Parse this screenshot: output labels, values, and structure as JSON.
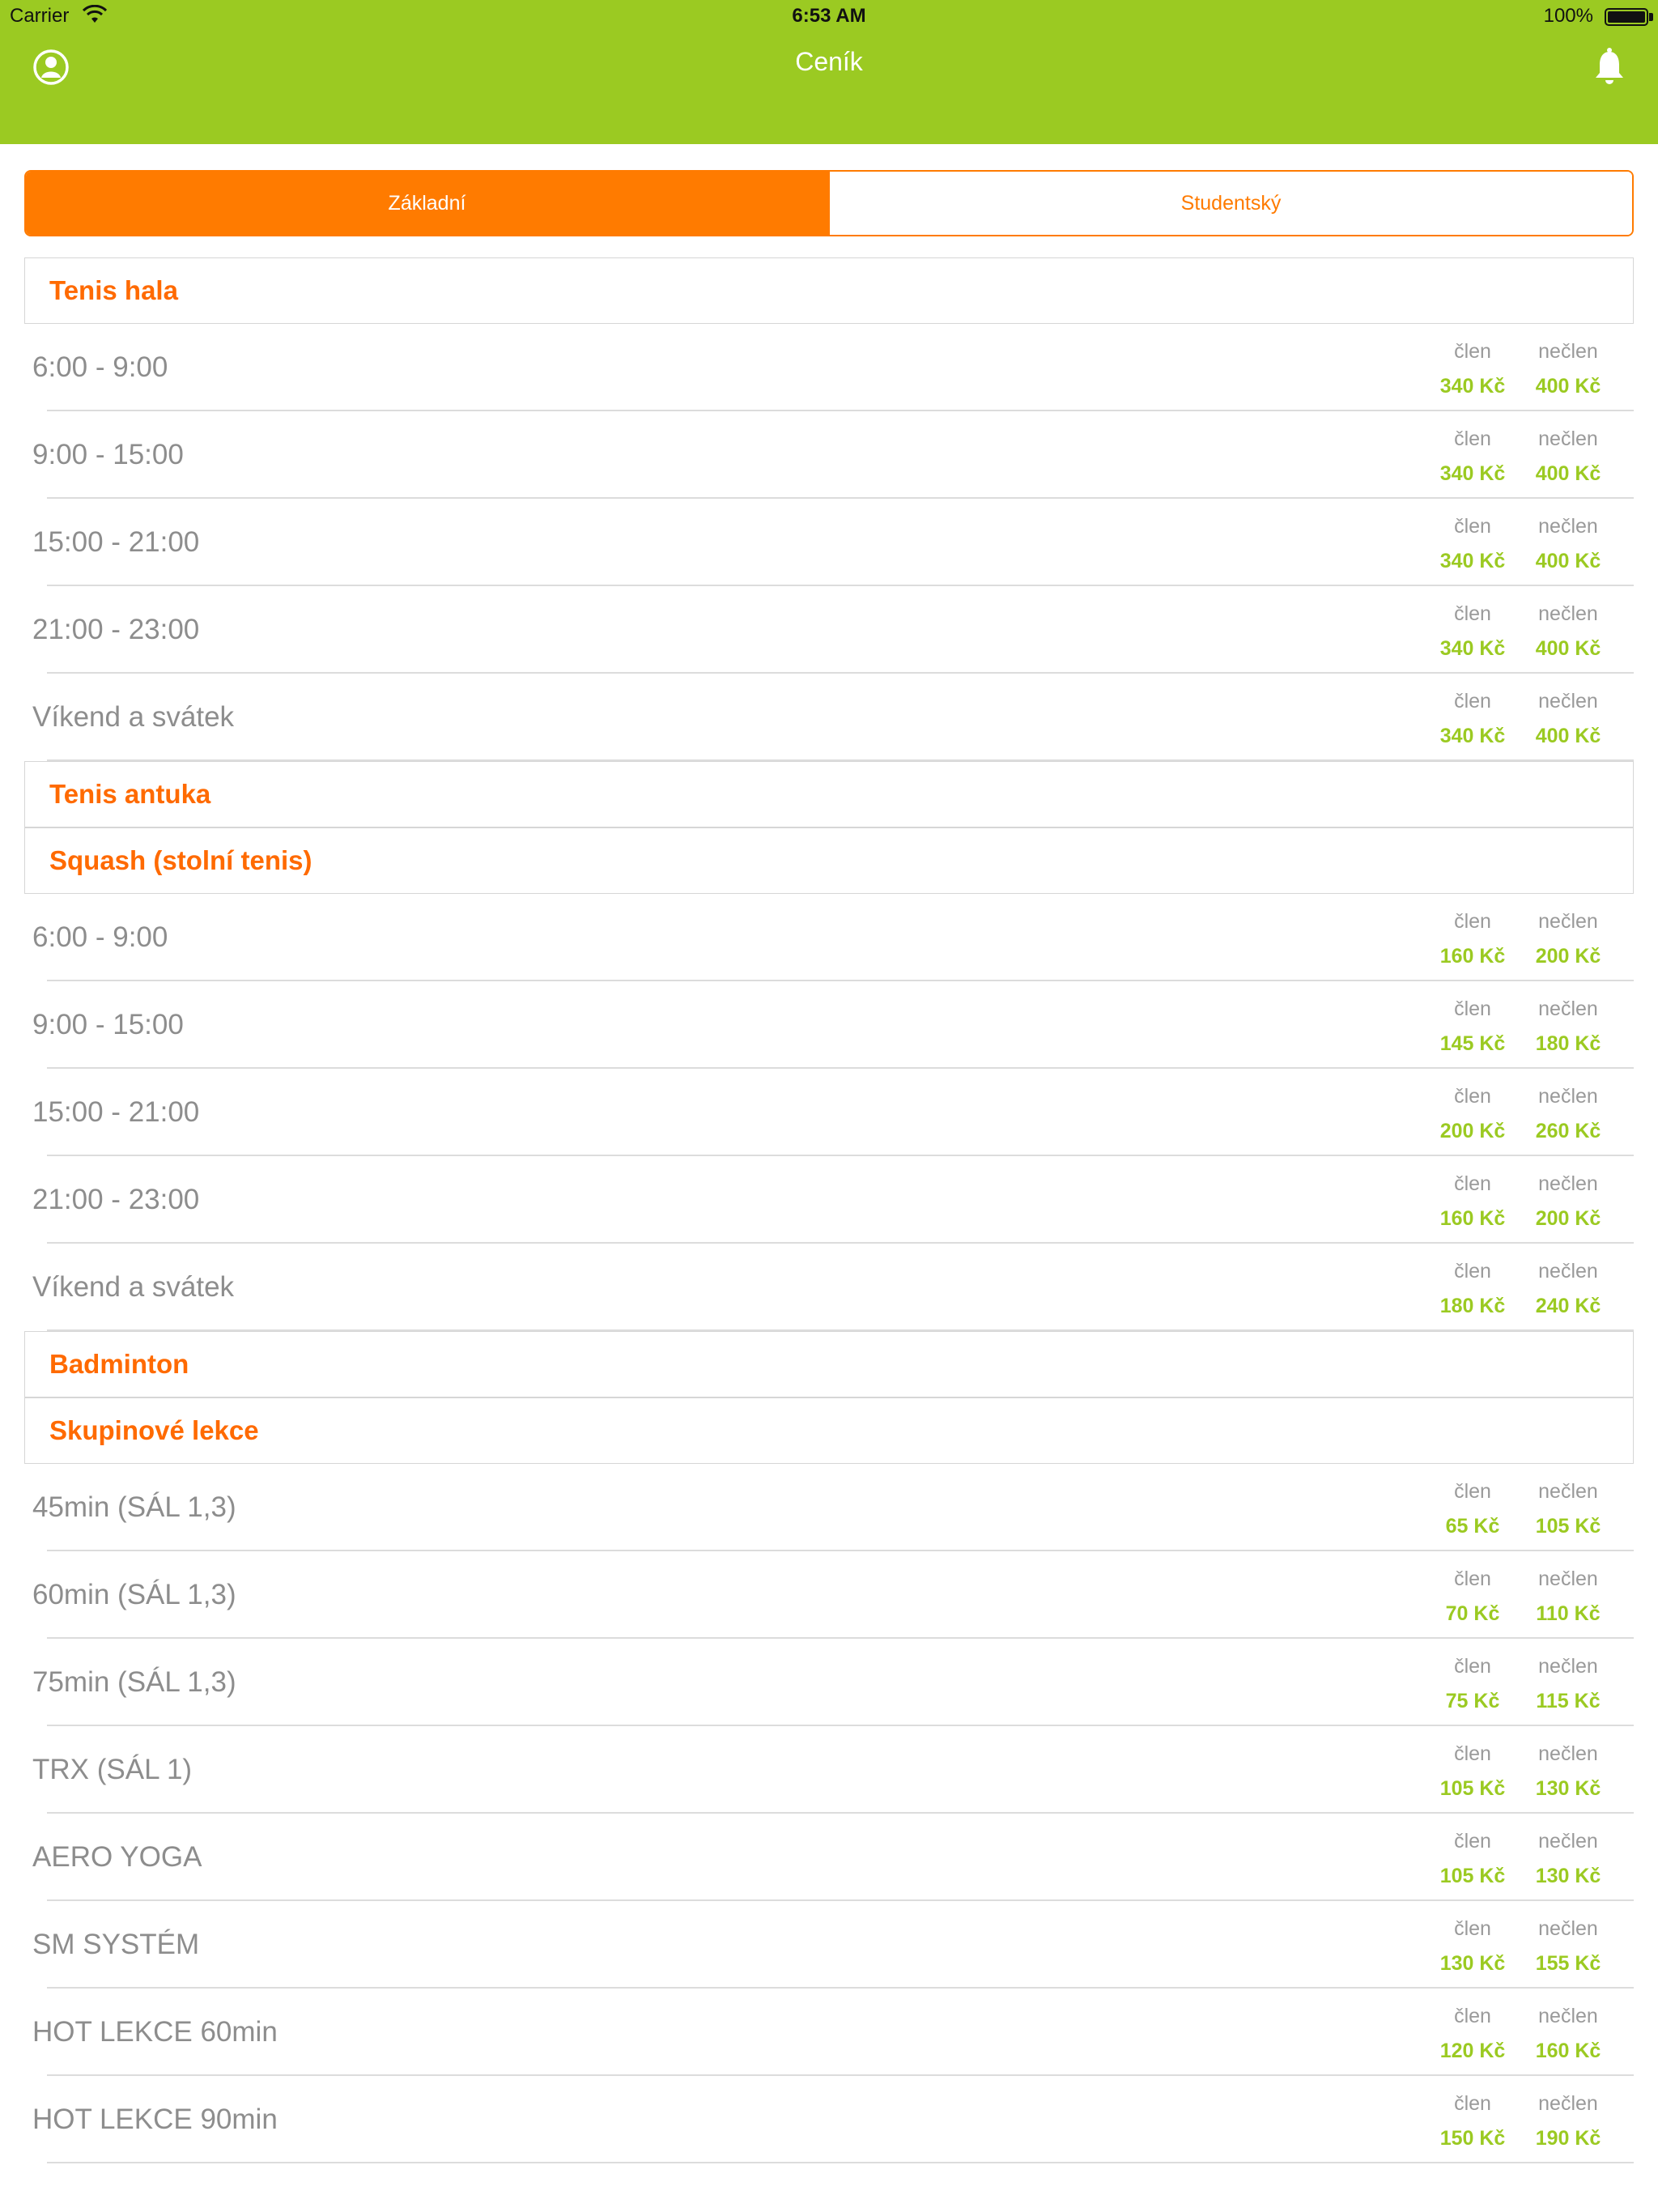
{
  "status_bar": {
    "carrier": "Carrier",
    "time": "6:53 AM",
    "battery": "100%"
  },
  "header": {
    "title": "Ceník",
    "profile_icon": "profile-icon",
    "bell_icon": "bell-icon",
    "color": "#9bca22"
  },
  "tabs": [
    {
      "label": "Základní",
      "active": true
    },
    {
      "label": "Studentský",
      "active": false
    }
  ],
  "accent": "#ff7b00",
  "column_labels": {
    "member": "člen",
    "nonmember": "nečlen"
  },
  "sections": [
    {
      "title": "Tenis hala",
      "rows": [
        {
          "name": "6:00 - 9:00",
          "member": "340 Kč",
          "nonmember": "400 Kč"
        },
        {
          "name": "9:00 - 15:00",
          "member": "340 Kč",
          "nonmember": "400 Kč"
        },
        {
          "name": "15:00 - 21:00",
          "member": "340 Kč",
          "nonmember": "400 Kč"
        },
        {
          "name": "21:00 - 23:00",
          "member": "340 Kč",
          "nonmember": "400 Kč"
        },
        {
          "name": "Víkend a svátek",
          "member": "340 Kč",
          "nonmember": "400 Kč"
        }
      ]
    },
    {
      "title": "Tenis antuka",
      "rows": []
    },
    {
      "title": "Squash (stolní tenis)",
      "rows": [
        {
          "name": "6:00 - 9:00",
          "member": "160 Kč",
          "nonmember": "200 Kč"
        },
        {
          "name": "9:00 - 15:00",
          "member": "145 Kč",
          "nonmember": "180 Kč"
        },
        {
          "name": "15:00 - 21:00",
          "member": "200 Kč",
          "nonmember": "260 Kč"
        },
        {
          "name": "21:00 - 23:00",
          "member": "160 Kč",
          "nonmember": "200 Kč"
        },
        {
          "name": "Víkend a svátek",
          "member": "180 Kč",
          "nonmember": "240 Kč"
        }
      ]
    },
    {
      "title": "Badminton",
      "rows": []
    },
    {
      "title": "Skupinové lekce",
      "rows": [
        {
          "name": "45min (SÁL 1,3)",
          "member": "65 Kč",
          "nonmember": "105 Kč"
        },
        {
          "name": "60min (SÁL 1,3)",
          "member": "70 Kč",
          "nonmember": "110 Kč"
        },
        {
          "name": "75min (SÁL 1,3)",
          "member": "75 Kč",
          "nonmember": "115 Kč"
        },
        {
          "name": "TRX (SÁL 1)",
          "member": "105 Kč",
          "nonmember": "130 Kč"
        },
        {
          "name": "AERO YOGA",
          "member": "105 Kč",
          "nonmember": "130 Kč"
        },
        {
          "name": "SM SYSTÉM",
          "member": "130 Kč",
          "nonmember": "155 Kč"
        },
        {
          "name": "HOT LEKCE 60min",
          "member": "120 Kč",
          "nonmember": "160 Kč"
        },
        {
          "name": "HOT LEKCE 90min",
          "member": "150 Kč",
          "nonmember": "190 Kč"
        }
      ]
    }
  ]
}
